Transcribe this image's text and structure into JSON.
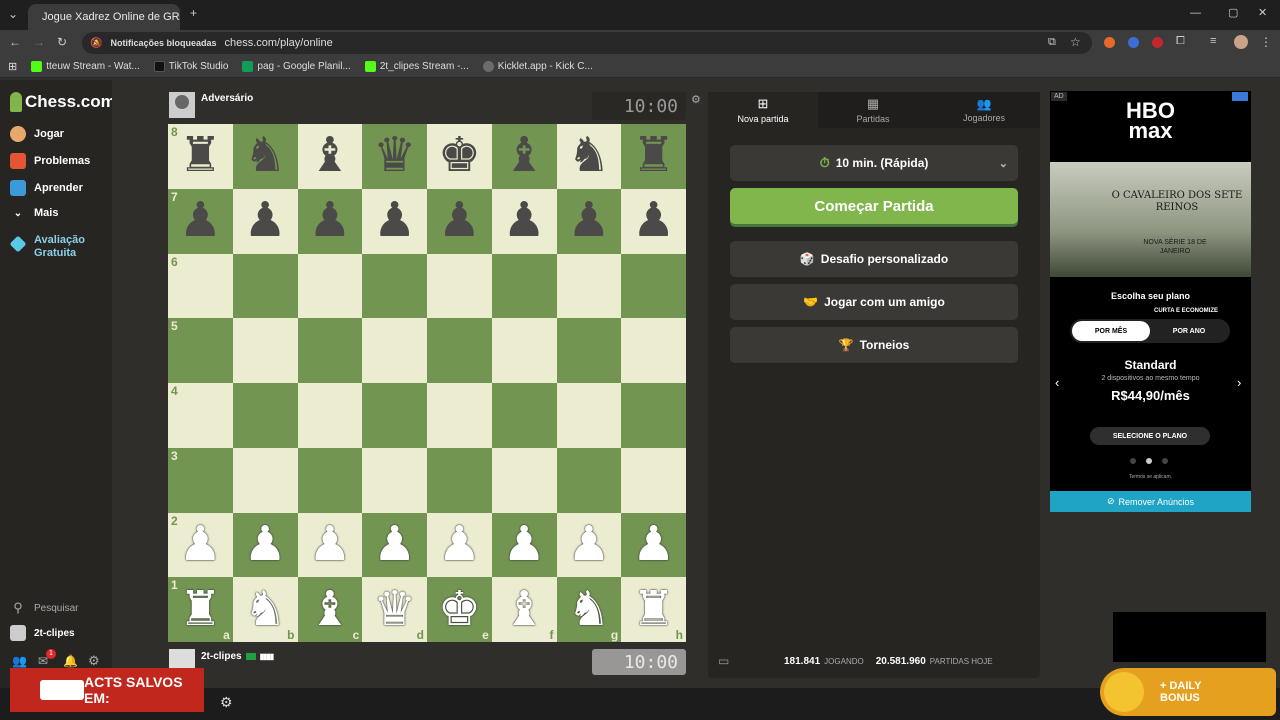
{
  "browser": {
    "tab_title": "Jogue Xadrez Online de GRAÇA",
    "notif_blocked": "Notificações bloqueadas",
    "url": "chess.com/play/online",
    "bookmarks": [
      {
        "label": "tteuw Stream - Wat..."
      },
      {
        "label": "TikTok Studio"
      },
      {
        "label": "pag - Google Planil..."
      },
      {
        "label": "2t_clipes Stream -..."
      },
      {
        "label": "Kicklet.app - Kick C..."
      }
    ]
  },
  "sidebar": {
    "logo": "Chess.com",
    "items": [
      {
        "label": "Jogar"
      },
      {
        "label": "Problemas"
      },
      {
        "label": "Aprender"
      },
      {
        "label": "Mais"
      },
      {
        "label": "Avaliação Gratuita"
      }
    ],
    "search": "Pesquisar",
    "user": "2t-clipes",
    "mail_badge": "1"
  },
  "game": {
    "opponent_name": "Adversário",
    "opponent_clock": "10:00",
    "player_name": "2t-clipes",
    "player_clock": "10:00",
    "ranks": [
      "8",
      "7",
      "6",
      "5",
      "4",
      "3",
      "2",
      "1"
    ],
    "files": [
      "a",
      "b",
      "c",
      "d",
      "e",
      "f",
      "g",
      "h"
    ]
  },
  "panel": {
    "tabs": [
      {
        "label": "Nova partida"
      },
      {
        "label": "Partidas"
      },
      {
        "label": "Jogadores"
      }
    ],
    "time_control": "10 min. (Rápida)",
    "start_button": "Começar Partida",
    "custom_challenge": "Desafio personalizado",
    "play_friend": "Jogar com um amigo",
    "tournaments": "Torneios",
    "playing_count": "181.841",
    "playing_label": "JOGANDO",
    "games_today_count": "20.581.960",
    "games_today_label": "PARTIDAS HOJE"
  },
  "ad": {
    "tag": "AD",
    "brand_top": "HBO",
    "brand_bottom": "max",
    "poster_title": "O CAVALEIRO DOS SETE REINOS",
    "poster_sub": "NOVA SÉRIE 18 DE JANEIRO",
    "choose_plan": "Escolha seu plano",
    "save_label": "CURTA E ECONOMIZE",
    "per_month": "POR MÊS",
    "per_year": "POR ANO",
    "plan_name": "Standard",
    "plan_devices": "2 dispositivos ao mesmo tempo",
    "plan_price": "R$44,90/mês",
    "select_plan": "SELECIONE O PLANO",
    "terms": "Termos se aplicam.",
    "remove_ads": "Remover Anúncios"
  },
  "overlays": {
    "banner_text": "ACTS SALVOS EM:",
    "daily_bonus": "+ DAILY BONUS"
  },
  "colors": {
    "light_square": "#ebecd0",
    "dark_square": "#739552",
    "start_green": "#81b64c"
  }
}
